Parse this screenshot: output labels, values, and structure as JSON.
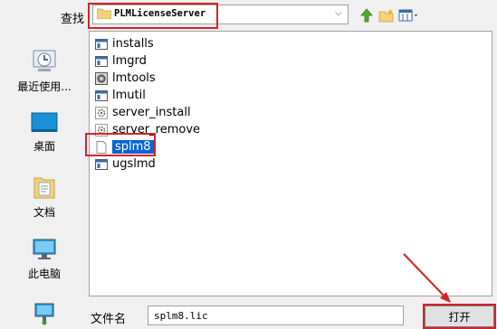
{
  "dialog": {
    "look_in_label": "查找",
    "current_path": "PLMLicenseServer",
    "colors": {
      "highlight": "#d6222a",
      "selection": "#0a64d2"
    }
  },
  "places": [
    {
      "label": "最近使用...",
      "icon": "recent-icon"
    },
    {
      "label": "桌面",
      "icon": "desktop-icon"
    },
    {
      "label": "文档",
      "icon": "documents-icon"
    },
    {
      "label": "此电脑",
      "icon": "computer-icon"
    },
    {
      "label": "",
      "icon": "network-icon"
    }
  ],
  "files": [
    {
      "name": "installs",
      "icon": "window-icon"
    },
    {
      "name": "lmgrd",
      "icon": "window-icon"
    },
    {
      "name": "lmtools",
      "icon": "tools-icon"
    },
    {
      "name": "lmutil",
      "icon": "window-icon"
    },
    {
      "name": "server_install",
      "icon": "gear-icon"
    },
    {
      "name": "server_remove",
      "icon": "gear-icon"
    },
    {
      "name": "splm8",
      "icon": "document-icon",
      "selected": true
    },
    {
      "name": "ugslmd",
      "icon": "window-icon"
    }
  ],
  "footer": {
    "filename_label": "文件名",
    "filename_value": "splm8.lic",
    "open_button": "打开"
  }
}
